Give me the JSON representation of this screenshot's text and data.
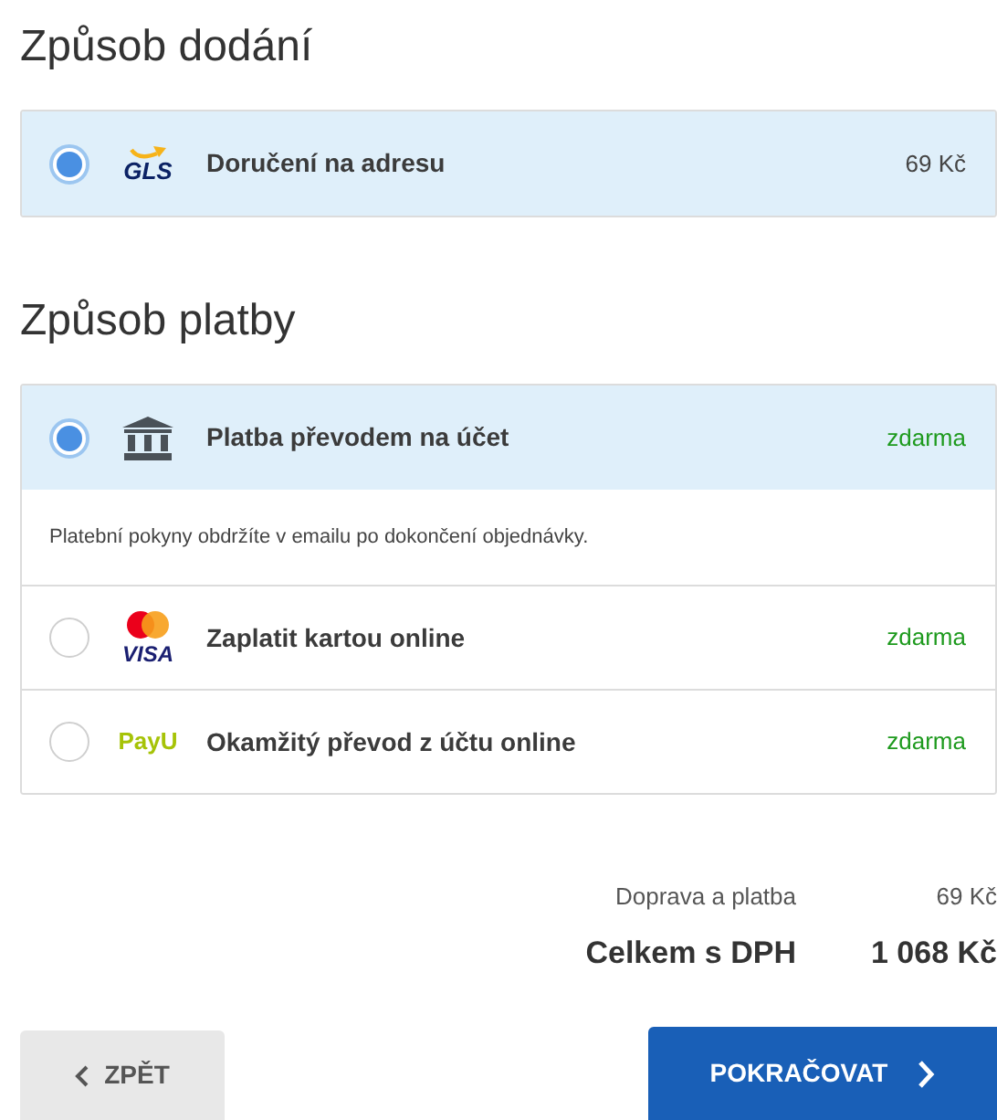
{
  "delivery": {
    "title": "Způsob dodání",
    "options": [
      {
        "kind": "gls",
        "logo": "GLS",
        "label": "Doručení na adresu",
        "price": "69 Kč",
        "selected": true
      }
    ]
  },
  "payment": {
    "title": "Způsob platby",
    "options": [
      {
        "kind": "bank",
        "label": "Platba převodem na účet",
        "price": "zdarma",
        "selected": true,
        "note": "Platební pokyny obdržíte v emailu po dokončení objednávky."
      },
      {
        "kind": "card",
        "logo": "VISA",
        "label": "Zaplatit kartou online",
        "price": "zdarma",
        "selected": false
      },
      {
        "kind": "payu",
        "logo": "PayU",
        "label": "Okamžitý převod z účtu online",
        "price": "zdarma",
        "selected": false
      }
    ]
  },
  "summary": [
    {
      "kind": "normal",
      "label": "Doprava a platba",
      "value": "69 Kč"
    },
    {
      "kind": "total",
      "label": "Celkem s DPH",
      "value": "1 068 Kč"
    }
  ],
  "buttons": {
    "back": "ZPĚT",
    "next": "POKRAČOVAT"
  }
}
